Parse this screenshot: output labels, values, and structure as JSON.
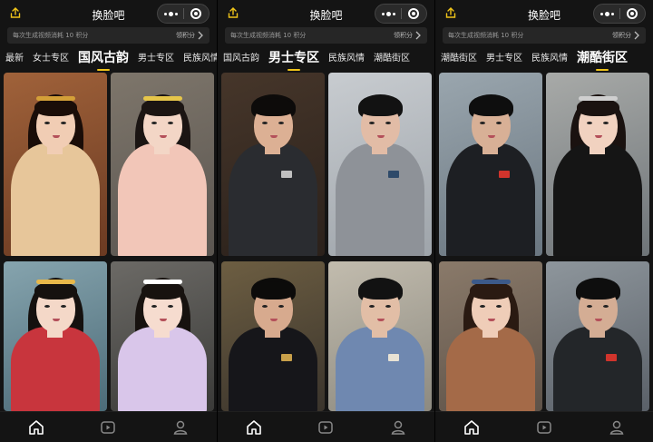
{
  "panels": [
    {
      "title": "换脸吧",
      "notice": "每次生成视频消耗 10 积分",
      "points_label": "领积分",
      "tabs": [
        "最新",
        "女士专区",
        "国风古韵",
        "男士专区",
        "民族风情"
      ],
      "active_tab": 2,
      "cards": [
        {
          "subject": "woman",
          "theme": "hanfu-red"
        },
        {
          "subject": "woman",
          "theme": "hanfu-pink"
        },
        {
          "subject": "woman",
          "theme": "hanfu-crown"
        },
        {
          "subject": "woman",
          "theme": "hanfu-white"
        }
      ]
    },
    {
      "title": "换脸吧",
      "notice": "每次生成视频消耗 10 积分",
      "points_label": "领积分",
      "tabs": [
        "国风古韵",
        "男士专区",
        "民族风情",
        "潮酷街区"
      ],
      "active_tab": 1,
      "cards": [
        {
          "subject": "man",
          "theme": "suit"
        },
        {
          "subject": "man",
          "theme": "hoodie"
        },
        {
          "subject": "man",
          "theme": "street"
        },
        {
          "subject": "man",
          "theme": "plaid"
        }
      ]
    },
    {
      "title": "换脸吧",
      "notice": "每次生成视频消耗 10 积分",
      "points_label": "领积分",
      "tabs": [
        "潮酷街区",
        "男士专区",
        "民族风情",
        "潮酷街区"
      ],
      "active_tab": 3,
      "cards": [
        {
          "subject": "man",
          "theme": "tactical"
        },
        {
          "subject": "woman",
          "theme": "motorbike"
        },
        {
          "subject": "woman",
          "theme": "casual"
        },
        {
          "subject": "man",
          "theme": "tactical-dark"
        }
      ]
    }
  ],
  "bottom_nav": [
    "home-icon",
    "video-icon",
    "profile-icon"
  ],
  "colors": {
    "accent": "#f0c419",
    "background": "#141414",
    "notice_bg": "#262626"
  }
}
